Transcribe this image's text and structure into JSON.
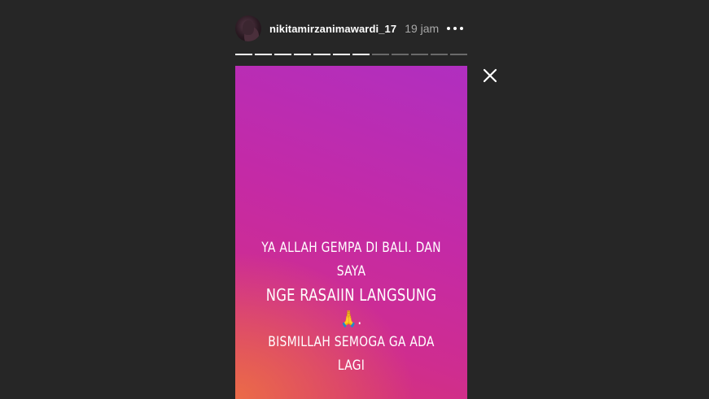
{
  "header": {
    "username": "nikitamirzanimawardi_17",
    "time": "19 jam",
    "more_icon": "ellipsis-icon"
  },
  "progress": {
    "total_segments": 12,
    "completed_segments": 7
  },
  "close_icon": "close-icon",
  "story": {
    "line1": "YA ALLAH GEMPA DI BALI. DAN SAYA",
    "line2": "NGE RASAIIN LANGSUNG 🙏.",
    "line3": "BISMILLAH SEMOGA GA ADA LAGI",
    "gradient_colors": [
      "#b02fc0",
      "#cf2d8f",
      "#ec6e46"
    ]
  }
}
